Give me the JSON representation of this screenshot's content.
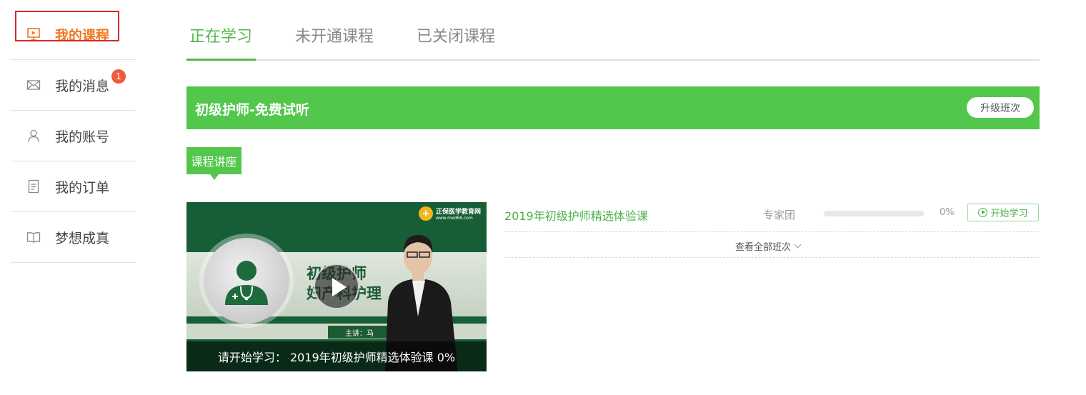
{
  "sidebar": {
    "items": [
      {
        "label": "我的课程",
        "icon": "presentation-icon"
      },
      {
        "label": "我的消息",
        "icon": "envelope-icon",
        "badge": "1"
      },
      {
        "label": "我的账号",
        "icon": "user-icon"
      },
      {
        "label": "我的订单",
        "icon": "document-icon"
      },
      {
        "label": "梦想成真",
        "icon": "open-book-icon"
      }
    ]
  },
  "tabs": [
    {
      "label": "正在学习"
    },
    {
      "label": "未开通课程"
    },
    {
      "label": "已关闭课程"
    }
  ],
  "course": {
    "title": "初级护师-免费试听",
    "upgrade_label": "升级班次",
    "section_tag": "课程讲座",
    "video": {
      "logo_text": "正保医学教育网",
      "logo_url": "www.med66.com",
      "slide_text_line1": "初级护师",
      "slide_text_line2": "妇产科护理",
      "presenter": "主讲：马",
      "caption": "请开始学习： 2019年初级护师精选体验课 0%"
    },
    "lesson": {
      "name": "2019年初级护师精选体验课",
      "teacher": "专家团",
      "progress": 0,
      "progress_text": "0%",
      "start_label": "开始学习"
    },
    "view_all_label": "查看全部班次"
  },
  "colors": {
    "accent_green": "#52c74b",
    "active_orange": "#f0781e",
    "badge_red": "#f05a3c"
  }
}
